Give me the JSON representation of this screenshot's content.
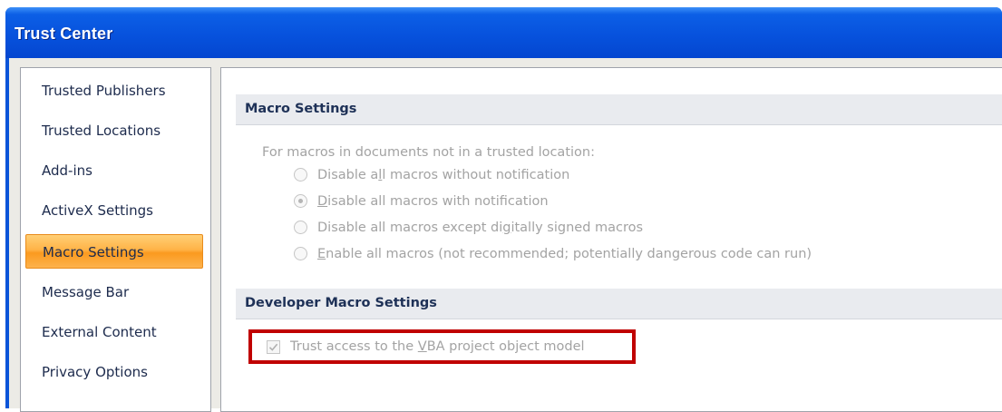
{
  "window": {
    "title": "Trust Center"
  },
  "sidebar": {
    "items": [
      {
        "label": "Trusted Publishers"
      },
      {
        "label": "Trusted Locations"
      },
      {
        "label": "Add-ins"
      },
      {
        "label": "ActiveX Settings"
      },
      {
        "label": "Macro Settings",
        "selected": true
      },
      {
        "label": "Message Bar"
      },
      {
        "label": "External Content"
      },
      {
        "label": "Privacy Options"
      }
    ]
  },
  "macro_settings": {
    "header": "Macro Settings",
    "description": "For macros in documents not in a trusted location:",
    "options": [
      {
        "pre": "Disable a",
        "ul": "l",
        "post": "l macros without notification",
        "selected": false
      },
      {
        "pre": "",
        "ul": "D",
        "post": "isable all macros with notification",
        "selected": true
      },
      {
        "pre": "Disable all macros except di",
        "ul": "g",
        "post": "itally signed macros",
        "selected": false
      },
      {
        "pre": "",
        "ul": "E",
        "post": "nable all macros (not recommended; potentially dangerous code can run)",
        "selected": false
      }
    ]
  },
  "developer_macro_settings": {
    "header": "Developer Macro Settings",
    "checkbox": {
      "pre": "Trust access to the ",
      "ul": "V",
      "post": "BA project object model",
      "checked": true
    }
  },
  "colors": {
    "title_bar": "#0752dd",
    "selected_item": "#ffb347",
    "highlight_border": "#c00000",
    "disabled_text": "#a3a3a3"
  }
}
